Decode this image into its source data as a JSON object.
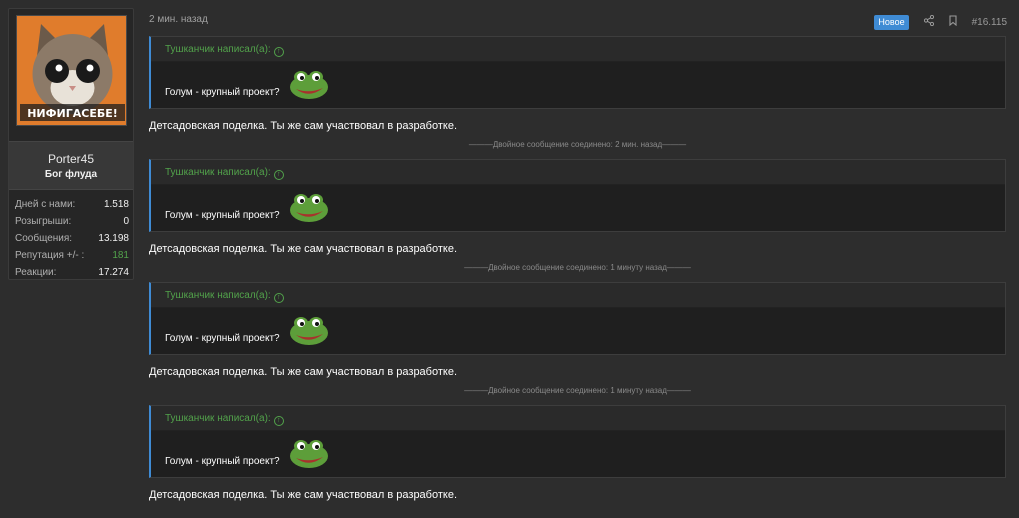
{
  "user": {
    "avatar_caption": "НИФИГАСЕБЕ!",
    "username": "Porter45",
    "title": "Бог флуда",
    "stats": [
      {
        "label": "Дней с нами:",
        "value": "1.518"
      },
      {
        "label": "Розыгрыши:",
        "value": "0"
      },
      {
        "label": "Сообщения:",
        "value": "13.198"
      },
      {
        "label": "Репутация +/- :",
        "value": "181"
      },
      {
        "label": "Реакции:",
        "value": "17.274"
      }
    ]
  },
  "post": {
    "time": "2 мин. назад",
    "badge": "Новое",
    "share_icon": "share-icon",
    "bookmark_icon": "bookmark-icon",
    "number": "#16.115",
    "segments": [
      {
        "quote_author": "Тушканчик написал(а):",
        "quote_text": "Голум - крупный проект?",
        "reply": "Детсадовская поделка. Ты же сам участвовал в разработке."
      },
      {
        "quote_author": "Тушканчик написал(а):",
        "quote_text": "Голум - крупный проект?",
        "reply": "Детсадовская поделка. Ты же сам участвовал в разработке."
      },
      {
        "quote_author": "Тушканчик написал(а):",
        "quote_text": "Голум - крупный проект?",
        "reply": "Детсадовская поделка. Ты же сам участвовал в разработке."
      },
      {
        "quote_author": "Тушканчик написал(а):",
        "quote_text": "Голум - крупный проект?",
        "reply": "Детсадовская поделка. Ты же сам участвовал в разработке."
      }
    ],
    "merge_notes": [
      "———Двойное сообщение соединено: 2 мин. назад———",
      "———Двойное сообщение соединено: 1 минуту назад———",
      "———Двойное сообщение соединено: 1 минуту назад———"
    ]
  },
  "colors": {
    "background": "#2d2d2d",
    "accent_blue": "#3f8bd4",
    "accent_green": "#52a24b"
  }
}
